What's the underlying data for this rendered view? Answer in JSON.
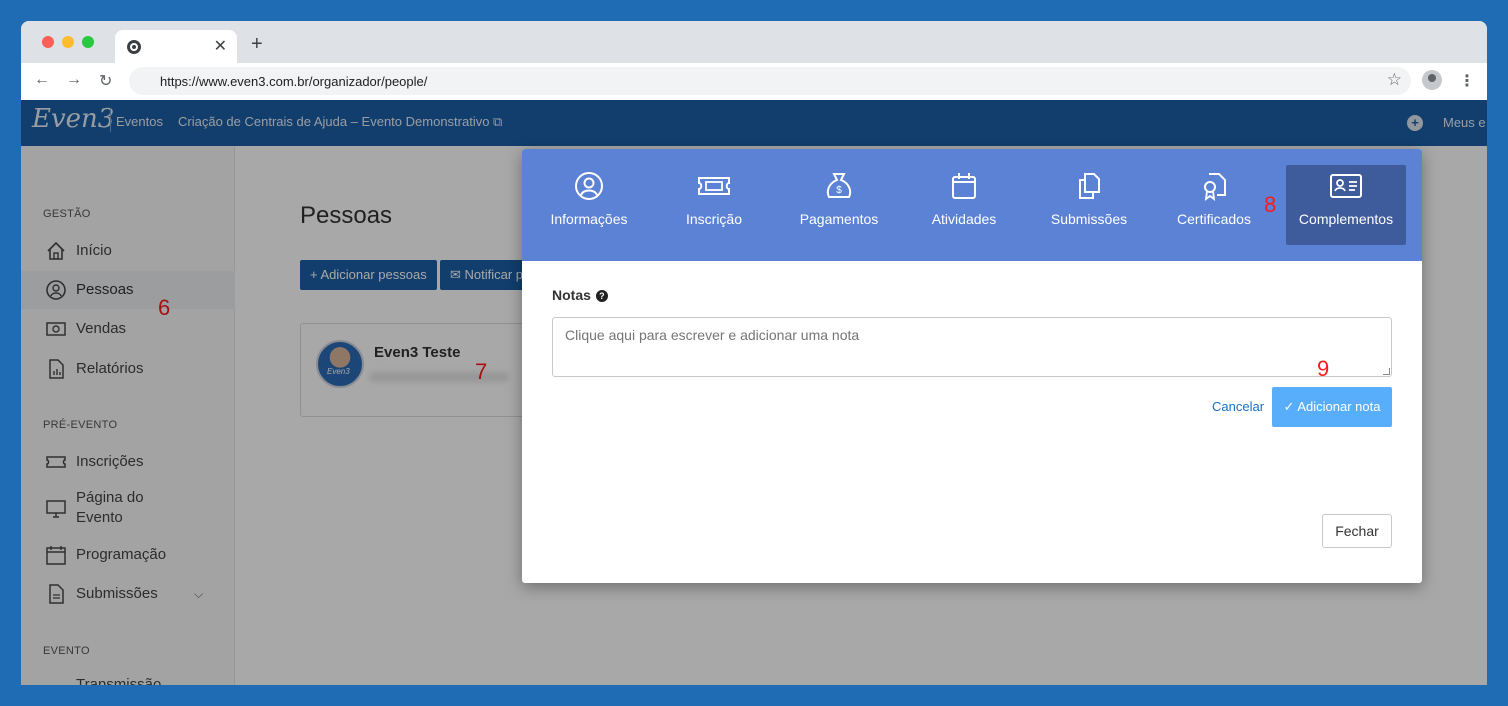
{
  "browser": {
    "url": "https://www.even3.com.br/organizador/people/",
    "close_glyph": "✕",
    "new_tab_glyph": "+",
    "back_glyph": "←",
    "forward_glyph": "→",
    "reload_glyph": "↻",
    "star_glyph": "☆",
    "menu_glyph": "⋮",
    "traffic_lights": [
      "#ff5f57",
      "#febc2e",
      "#28c840"
    ]
  },
  "app": {
    "logo": "Even3",
    "nav_eventos": "Eventos",
    "event_name": "Criação de Centrais de Ajuda – Evento Demonstrativo ⧉",
    "nav_plus": "+",
    "nav_right": "Meus e"
  },
  "sidebar": {
    "sections": {
      "gestao": "GESTÃO",
      "pre_evento": "PRÉ-EVENTO",
      "evento": "EVENTO"
    },
    "items": [
      {
        "label": "Início",
        "icon": "home-icon"
      },
      {
        "label": "Pessoas",
        "icon": "user-circle-icon"
      },
      {
        "label": "Vendas",
        "icon": "money-icon"
      },
      {
        "label": "Relatórios",
        "icon": "report-icon"
      },
      {
        "label": "Inscrições",
        "icon": "ticket-icon"
      },
      {
        "label": "Página do\nEvento",
        "icon": "monitor-icon"
      },
      {
        "label": "Programação",
        "icon": "calendar-icon"
      },
      {
        "label": "Submissões",
        "icon": "document-icon"
      },
      {
        "label": "Transmissão",
        "icon": "broadcast-icon"
      }
    ],
    "chevron": "⌵"
  },
  "main": {
    "title": "Pessoas",
    "add_people": "+ Adicionar pessoas",
    "notify": "✉ Notificar p",
    "person_name": "Even3 Teste",
    "avatar_text": "Even3"
  },
  "annotations": [
    "6",
    "7",
    "8",
    "9"
  ],
  "modal": {
    "tabs": [
      {
        "label": "Informações",
        "icon": "user-circle-icon"
      },
      {
        "label": "Inscrição",
        "icon": "ticket-icon"
      },
      {
        "label": "Pagamentos",
        "icon": "money-bag-icon"
      },
      {
        "label": "Atividades",
        "icon": "calendar-icon"
      },
      {
        "label": "Submissões",
        "icon": "copy-icon"
      },
      {
        "label": "Certificados",
        "icon": "certificate-icon"
      },
      {
        "label": "Complementos",
        "icon": "id-card-icon",
        "active": true
      }
    ],
    "notes_label": "Notas",
    "help": "?",
    "notes_placeholder": "Clique aqui para escrever e adicionar uma nota",
    "cancel": "Cancelar",
    "add_note": "✓ Adicionar nota",
    "close": "Fechar"
  },
  "colors": {
    "brand_blue": "#1a5fa6",
    "modal_header": "#5b82d4",
    "modal_tab_active": "#3e5b9c",
    "add_note_button": "#59aefc",
    "annotation_red": "#ff1a1a"
  }
}
